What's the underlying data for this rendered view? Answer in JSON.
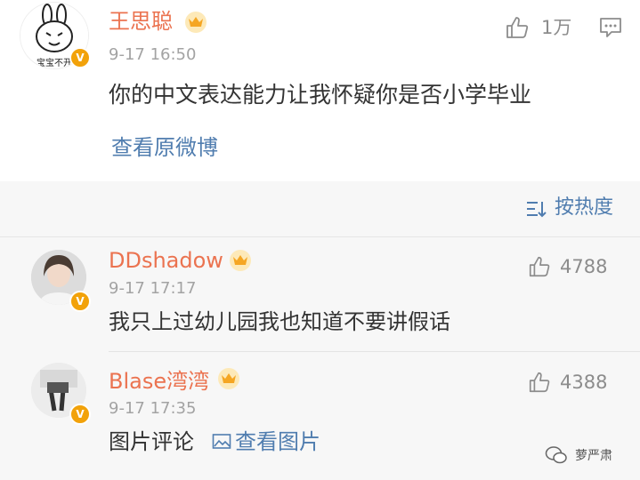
{
  "post": {
    "username": "王思聪",
    "timestamp": "9-17 16:50",
    "text": "你的中文表达能力让我怀疑你是否小学毕业",
    "like_count": "1万",
    "view_original": "查看原微博",
    "avatar_text": "宝宝不开"
  },
  "sort": {
    "label": "按热度"
  },
  "comments": [
    {
      "username": "DDshadow",
      "timestamp": "9-17 17:17",
      "text": "我只上过幼儿园我也知道不要讲假话",
      "like_count": "4788"
    },
    {
      "username": "Blase湾湾",
      "timestamp": "9-17 17:35",
      "text": "图片评论",
      "image_link": "查看图片",
      "like_count": "4388"
    }
  ],
  "watermark": {
    "text": "萝严肃"
  },
  "colors": {
    "username": "#eb7350",
    "link": "#507daf",
    "verified_badge": "#f2a20a",
    "crown": "#f5a623"
  }
}
